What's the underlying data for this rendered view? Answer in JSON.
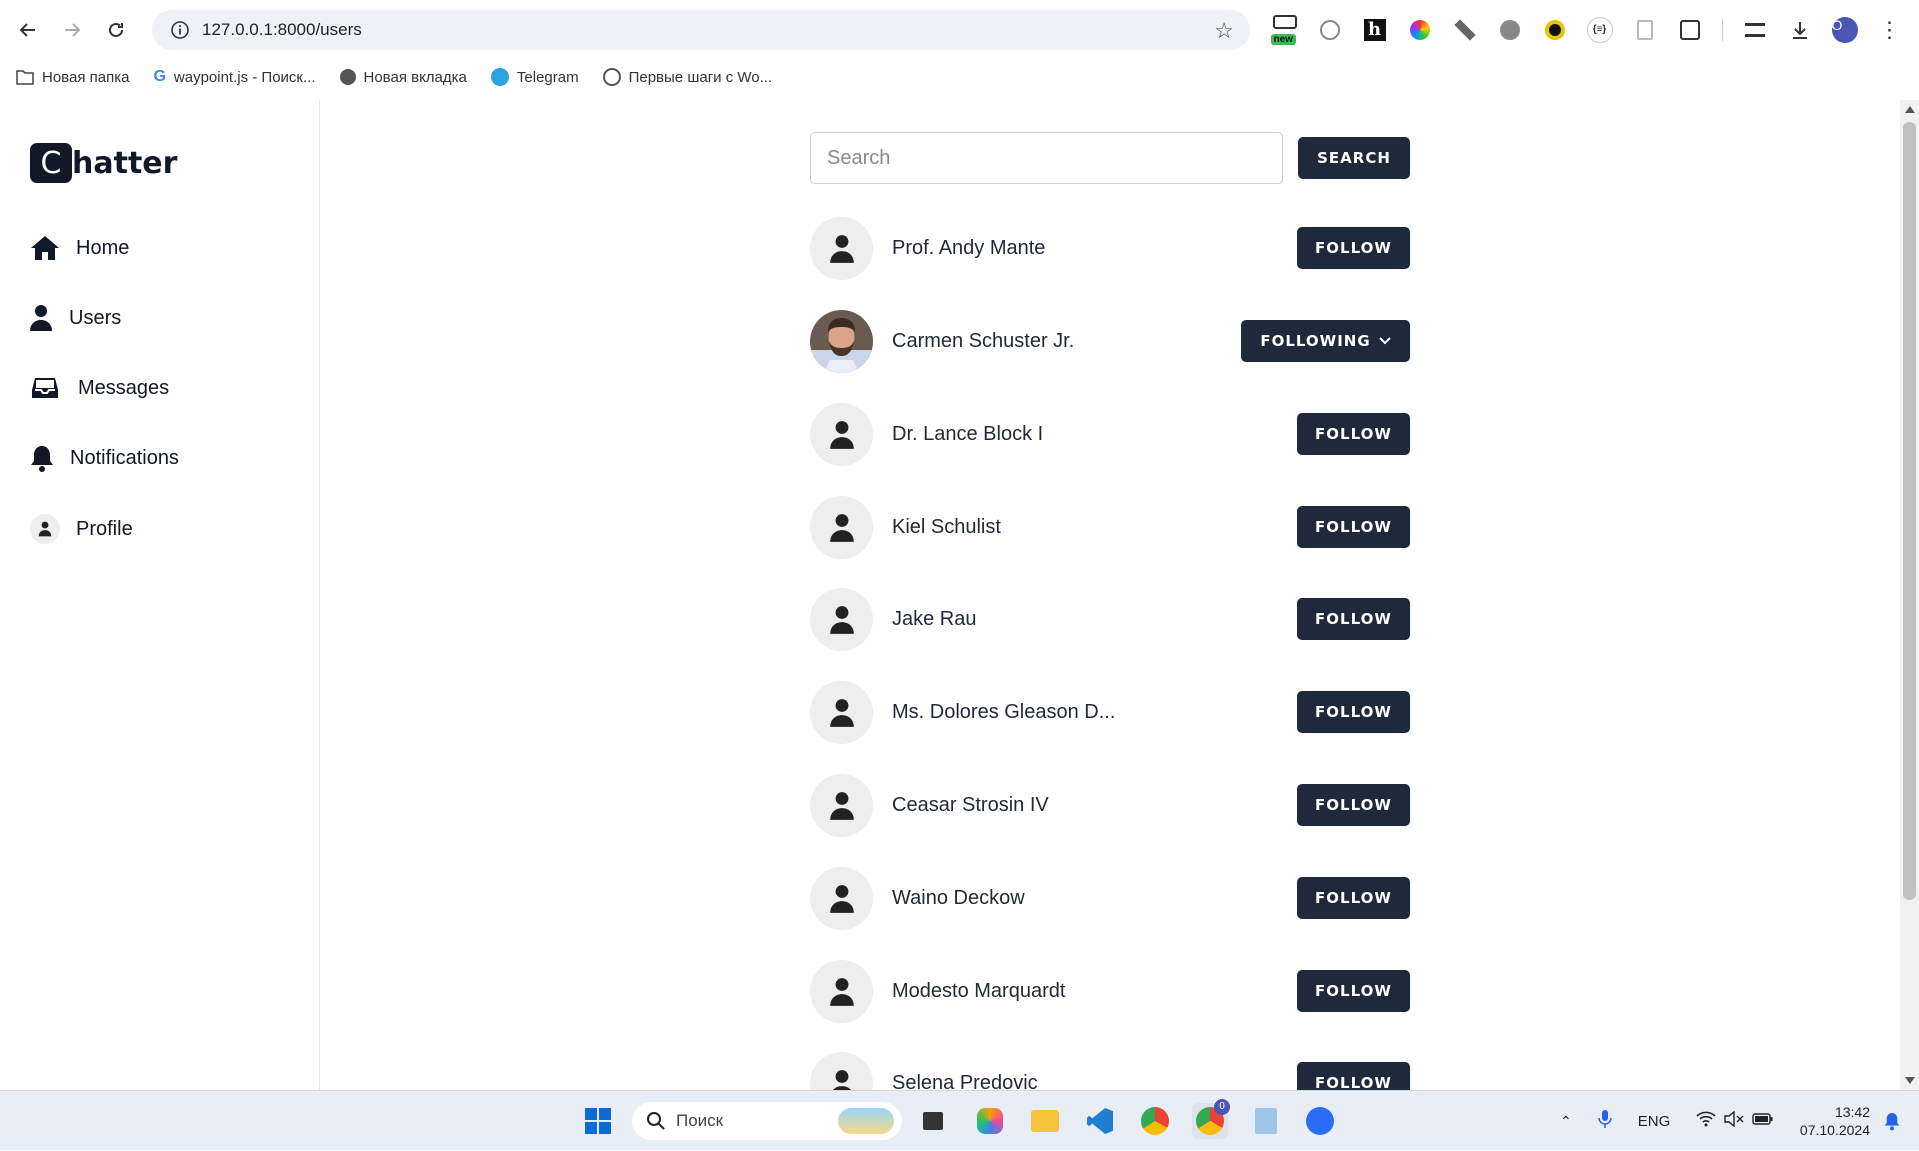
{
  "browser": {
    "url": "127.0.0.1:8000/users",
    "profile_initial": "O",
    "extension_badge": "new"
  },
  "bookmarks": [
    {
      "label": "Новая папка",
      "icon": "folder-icon"
    },
    {
      "label": "waypoint.js - Поиск...",
      "icon": "google-icon"
    },
    {
      "label": "Новая вкладка",
      "icon": "globe-icon"
    },
    {
      "label": "Telegram",
      "icon": "telegram-icon"
    },
    {
      "label": "Первые шаги с Wo...",
      "icon": "wordpress-icon"
    }
  ],
  "app": {
    "logo_letter": "C",
    "logo_rest": "hatter"
  },
  "sidebar": {
    "items": [
      {
        "label": "Home",
        "icon": "home-icon"
      },
      {
        "label": "Users",
        "icon": "user-icon"
      },
      {
        "label": "Messages",
        "icon": "inbox-icon"
      },
      {
        "label": "Notifications",
        "icon": "bell-icon"
      },
      {
        "label": "Profile",
        "icon": "avatar-icon"
      }
    ]
  },
  "search": {
    "placeholder": "Search",
    "button_label": "SEARCH"
  },
  "users": [
    {
      "name": "Prof. Andy Mante",
      "action": "FOLLOW",
      "photo": false
    },
    {
      "name": "Carmen Schuster Jr.",
      "action": "FOLLOWING",
      "photo": true
    },
    {
      "name": "Dr. Lance Block I",
      "action": "FOLLOW",
      "photo": false
    },
    {
      "name": "Kiel Schulist",
      "action": "FOLLOW",
      "photo": false
    },
    {
      "name": "Jake Rau",
      "action": "FOLLOW",
      "photo": false
    },
    {
      "name": "Ms. Dolores Gleason D...",
      "action": "FOLLOW",
      "photo": false
    },
    {
      "name": "Ceasar Strosin IV",
      "action": "FOLLOW",
      "photo": false
    },
    {
      "name": "Waino Deckow",
      "action": "FOLLOW",
      "photo": false
    },
    {
      "name": "Modesto Marquardt",
      "action": "FOLLOW",
      "photo": false
    },
    {
      "name": "Selena Predovic",
      "action": "FOLLOW",
      "photo": false
    }
  ],
  "taskbar": {
    "search_placeholder": "Поиск",
    "language": "ENG",
    "time": "13:42",
    "date": "07.10.2024",
    "chrome_badge": "0"
  },
  "colors": {
    "button_bg": "#1e293b",
    "logo_bg": "#111827",
    "avatar_bg": "#eeeeee"
  }
}
